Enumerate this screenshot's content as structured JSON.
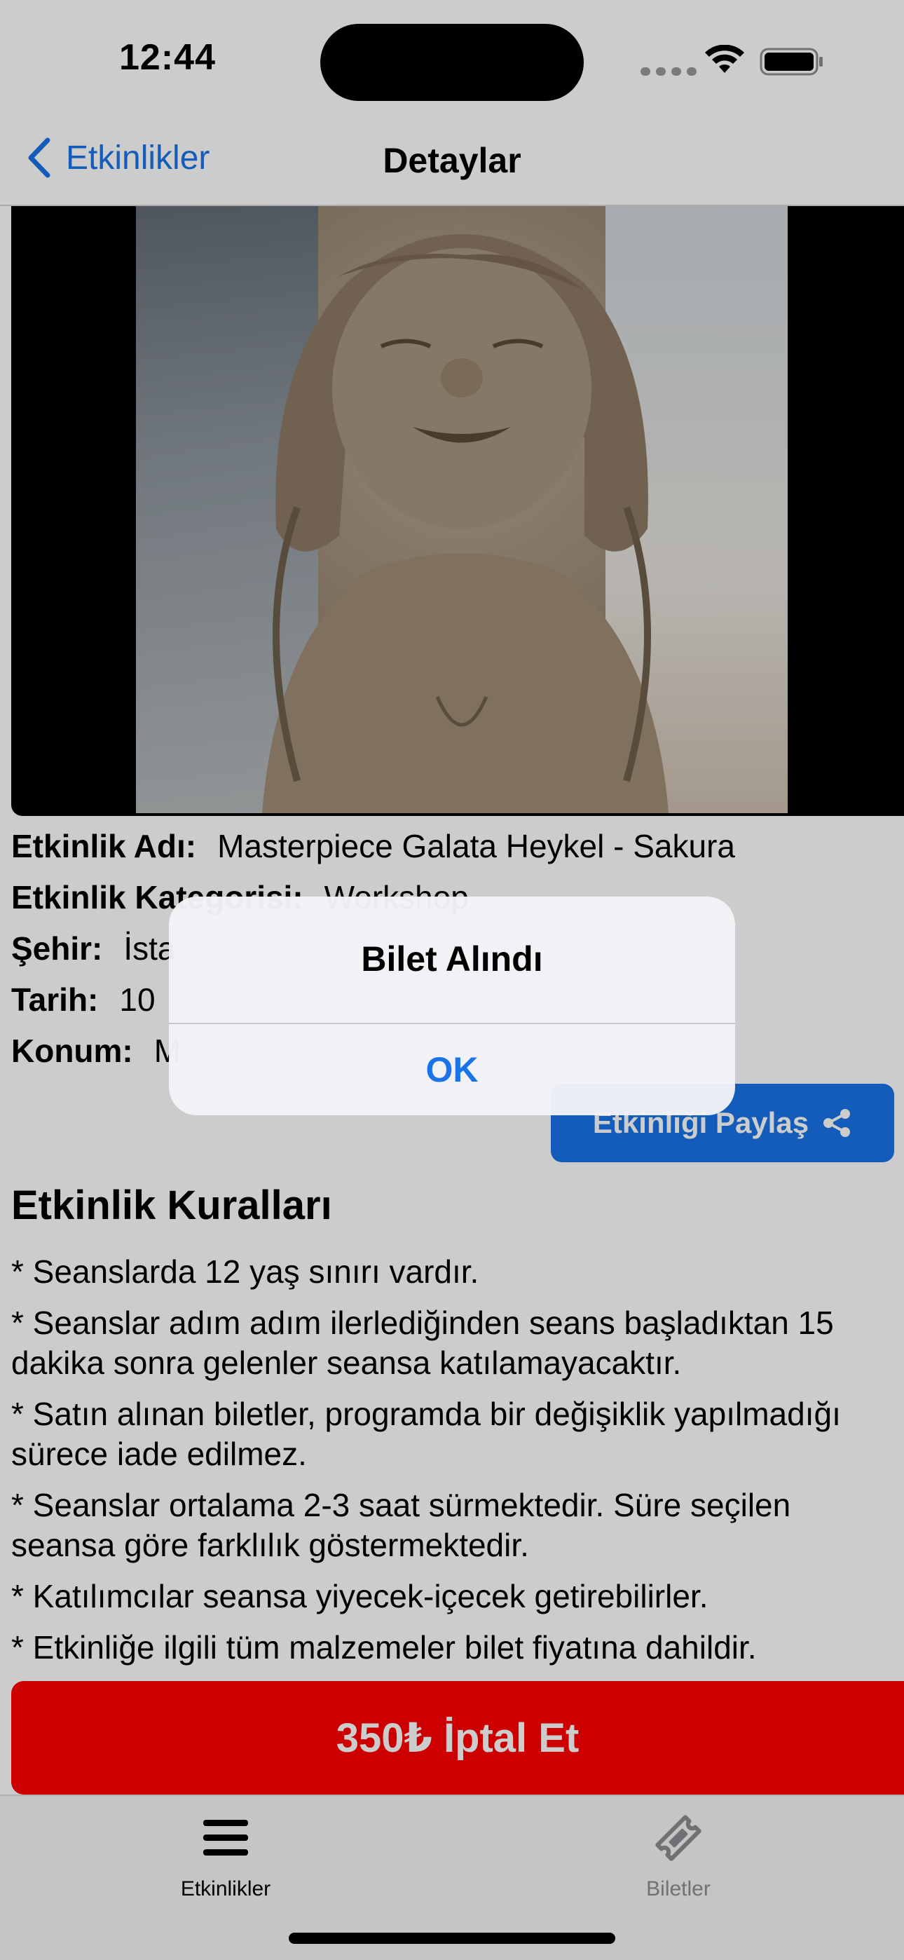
{
  "status_bar": {
    "time": "12:44"
  },
  "nav": {
    "back_label": "Etkinlikler",
    "title": "Detaylar"
  },
  "event": {
    "fields": [
      {
        "key": "Etkinlik Adı:",
        "value": "Masterpiece Galata Heykel - Sakura"
      },
      {
        "key": "Etkinlik Kategorisi:",
        "value": "Workshop"
      },
      {
        "key": "Şehir:",
        "value": "İsta"
      },
      {
        "key": "Tarih:",
        "value": "10"
      },
      {
        "key": "Konum:",
        "value": "M"
      }
    ]
  },
  "share_button": {
    "label": "Etkinliği Paylaş"
  },
  "rules": {
    "title": "Etkinlik Kuralları",
    "items": [
      "* Seanslarda 12 yaş sınırı vardır.",
      "* Seanslar adım adım ilerlediğinden seans başladıktan 15\ndakika sonra gelenler seansa katılamayacaktır.",
      "* Satın alınan biletler, programda bir değişiklik yapılmadığı\nsürece iade edilmez.",
      "* Seanslar ortalama 2-3 saat sürmektedir. Süre seçilen\nseansa göre farklılık göstermektedir.",
      "* Katılımcılar seansa yiyecek-içecek getirebilirler.",
      "* Etkinliğe ilgili tüm malzemeler bilet fiyatına dahildir."
    ]
  },
  "cta": {
    "label": "350₺ İptal Et"
  },
  "tabs": [
    {
      "label": "Etkinlikler",
      "icon": "list-icon",
      "selected": true
    },
    {
      "label": "Biletler",
      "icon": "ticket-icon",
      "selected": false
    }
  ],
  "alert": {
    "title": "Bilet Alındı",
    "ok_label": "OK"
  },
  "colors": {
    "accent": "#1a73e8",
    "danger": "#ff0000"
  }
}
